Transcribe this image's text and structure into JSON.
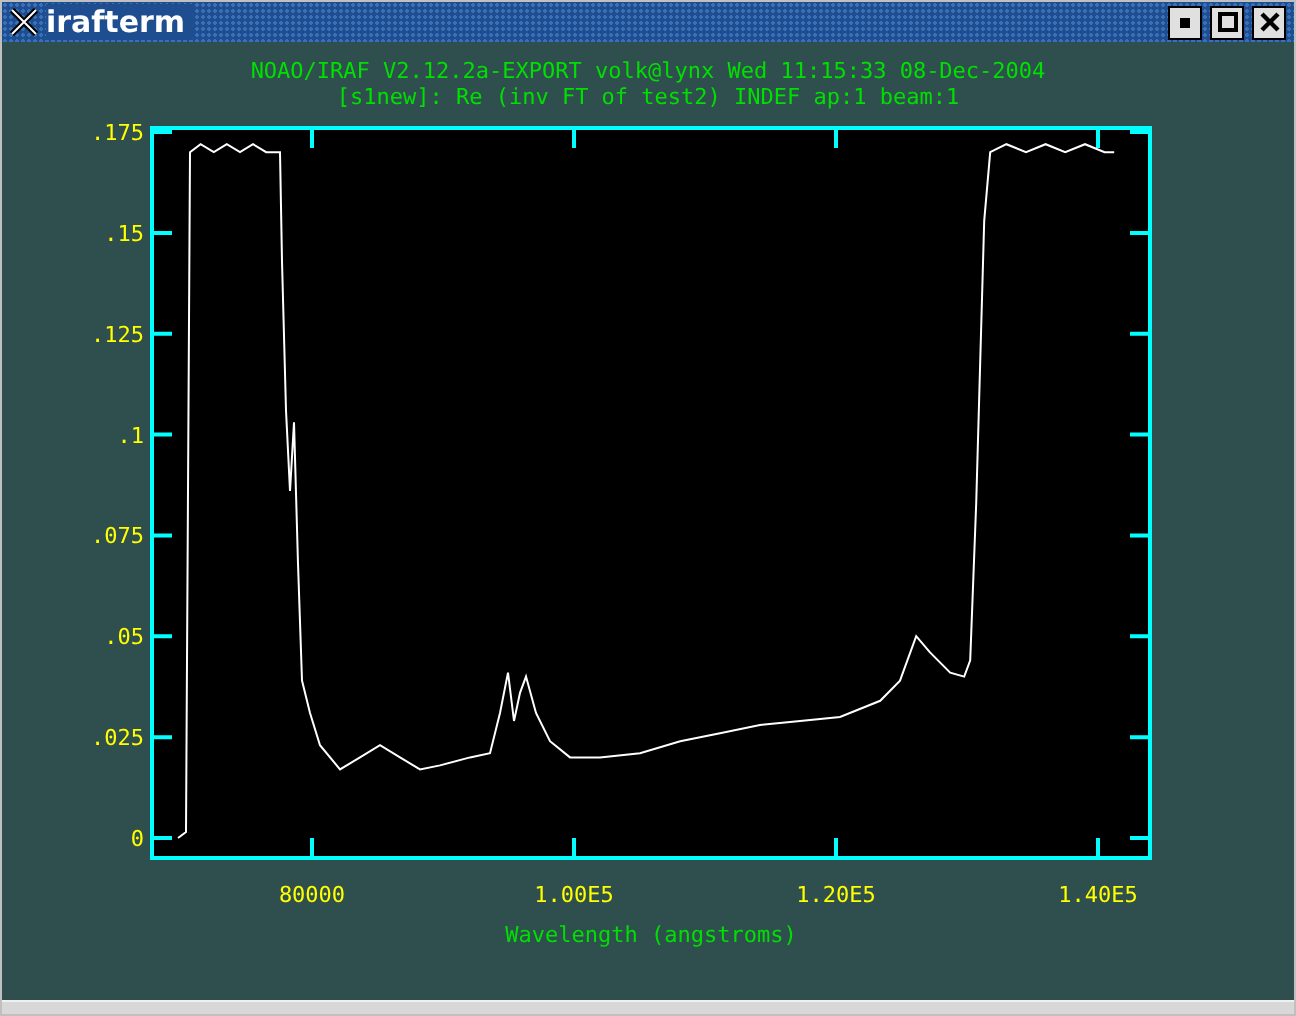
{
  "window": {
    "title": "irafterm"
  },
  "header": [
    "NOAO/IRAF V2.12.2a-EXPORT volk@lynx Wed 11:15:33 08-Dec-2004",
    "[s1new]: Re (inv FT of test2) INDEF ap:1 beam:1"
  ],
  "chart_data": {
    "type": "line",
    "xlabel": "Wavelength (angstroms)",
    "xlim": [
      67786,
      143969
    ],
    "ylim": [
      -0.00496,
      0.176
    ],
    "xticks": [
      {
        "value": 80000,
        "label": "80000"
      },
      {
        "value": 100000,
        "label": "1.00E5"
      },
      {
        "value": 120000,
        "label": "1.20E5"
      },
      {
        "value": 140000,
        "label": "1.40E5"
      }
    ],
    "yticks": [
      {
        "value": 0,
        "label": "0"
      },
      {
        "value": 0.025,
        "label": ".025"
      },
      {
        "value": 0.05,
        "label": ".05"
      },
      {
        "value": 0.075,
        "label": ".075"
      },
      {
        "value": 0.1,
        "label": ".1"
      },
      {
        "value": 0.125,
        "label": ".125"
      },
      {
        "value": 0.15,
        "label": ".15"
      },
      {
        "value": 0.175,
        "label": ".175"
      }
    ],
    "x": [
      69770,
      70380,
      70690,
      71500,
      72500,
      73500,
      74500,
      75500,
      76500,
      77557,
      77710,
      78015,
      78320,
      78630,
      78930,
      79240,
      79850,
      80610,
      82140,
      83660,
      85190,
      86720,
      88250,
      89770,
      92060,
      93590,
      94350,
      94960,
      95420,
      95880,
      96340,
      97100,
      98170,
      99700,
      101990,
      105040,
      108100,
      111150,
      114200,
      117260,
      120310,
      123370,
      124890,
      126120,
      127180,
      128710,
      129780,
      130240,
      130700,
      131310,
      131770,
      133000,
      134500,
      136000,
      137500,
      139000,
      140500,
      141230
    ],
    "series": [
      {
        "color": "#ffffff",
        "values": [
          0,
          0.0015,
          0.17,
          0.172,
          0.17,
          0.172,
          0.17,
          0.172,
          0.17,
          0.17,
          0.143,
          0.106,
          0.086,
          0.103,
          0.068,
          0.039,
          0.031,
          0.023,
          0.017,
          0.02,
          0.023,
          0.02,
          0.017,
          0.018,
          0.02,
          0.021,
          0.031,
          0.041,
          0.029,
          0.036,
          0.04,
          0.031,
          0.024,
          0.02,
          0.02,
          0.021,
          0.024,
          0.026,
          0.028,
          0.029,
          0.03,
          0.034,
          0.039,
          0.05,
          0.046,
          0.041,
          0.04,
          0.044,
          0.083,
          0.153,
          0.17,
          0.172,
          0.17,
          0.172,
          0.17,
          0.172,
          0.17,
          0.17
        ]
      }
    ]
  }
}
